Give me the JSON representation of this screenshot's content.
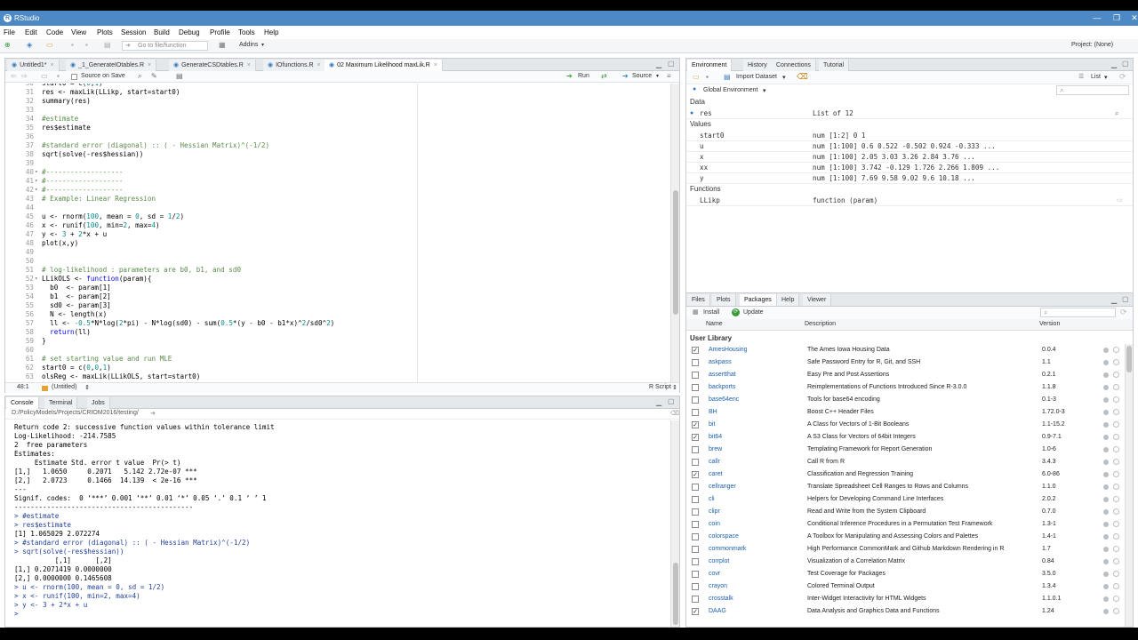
{
  "titlebar": {
    "app_name": "RStudio"
  },
  "menu": [
    "File",
    "Edit",
    "Code",
    "View",
    "Plots",
    "Session",
    "Build",
    "Debug",
    "Profile",
    "Tools",
    "Help"
  ],
  "toolbar": {
    "goto_placeholder": "Go to file/function",
    "addins": "Addins",
    "project": "Project: (None)"
  },
  "editor": {
    "tabs": [
      "Untitled1*",
      "_1_GenerateIOtables.R",
      "GenerateCSDtables.R",
      "IOfunctions.R",
      "02 Maximum Likelihood maxLik.R"
    ],
    "source_on_save": "Source on Save",
    "run": "Run",
    "source": "Source",
    "status_pos": "48:1",
    "status_scope": "(Untitled)",
    "status_type": "R Script",
    "lines": [
      {
        "n": "30",
        "t": "start0 = c(0,1)"
      },
      {
        "n": "31",
        "t": "res <- maxLik(LLikp, start=start0)"
      },
      {
        "n": "32",
        "t": "summary(res)"
      },
      {
        "n": "33",
        "t": ""
      },
      {
        "n": "34",
        "t": "#estimate"
      },
      {
        "n": "35",
        "t": "res$estimate"
      },
      {
        "n": "36",
        "t": ""
      },
      {
        "n": "37",
        "t": "#standard error (diagonal) :: ( - Hessian Matrix)^(-1/2)"
      },
      {
        "n": "38",
        "t": "sqrt(solve(-res$hessian))"
      },
      {
        "n": "39",
        "t": ""
      },
      {
        "n": "40",
        "t": "#-------------------"
      },
      {
        "n": "41",
        "t": "#-------------------"
      },
      {
        "n": "42",
        "t": "#-------------------"
      },
      {
        "n": "43",
        "t": "# Example: Linear Regression"
      },
      {
        "n": "44",
        "t": ""
      },
      {
        "n": "45",
        "t": "u <- rnorm(100, mean = 0, sd = 1/2)"
      },
      {
        "n": "46",
        "t": "x <- runif(100, min=2, max=4)"
      },
      {
        "n": "47",
        "t": "y <- 3 + 2*x + u"
      },
      {
        "n": "48",
        "t": "plot(x,y)"
      },
      {
        "n": "49",
        "t": ""
      },
      {
        "n": "50",
        "t": ""
      },
      {
        "n": "51",
        "t": "# log-likelihood : parameters are b0, b1, and sd0"
      },
      {
        "n": "52",
        "t": "LLikOLS <- function(param){"
      },
      {
        "n": "53",
        "t": "  b0  <- param[1]"
      },
      {
        "n": "54",
        "t": "  b1  <- param[2]"
      },
      {
        "n": "55",
        "t": "  sd0 <- param[3]"
      },
      {
        "n": "56",
        "t": "  N <- length(x)"
      },
      {
        "n": "57",
        "t": "  ll <- -0.5*N*log(2*pi) - N*log(sd0) - sum(0.5*(y - b0 - b1*x)^2/sd0^2)"
      },
      {
        "n": "58",
        "t": "  return(ll)"
      },
      {
        "n": "59",
        "t": "}"
      },
      {
        "n": "60",
        "t": ""
      },
      {
        "n": "61",
        "t": "# set starting value and run MLE"
      },
      {
        "n": "62",
        "t": "start0 = c(0,0,1)"
      },
      {
        "n": "63",
        "t": "olsReg <- maxLik(LLikOLS, start=start0)"
      }
    ]
  },
  "console": {
    "tabs": [
      "Console",
      "Terminal",
      "Jobs"
    ],
    "path": "D:/PolicyModels/Projects/CRIOM2016/testing/",
    "lines": [
      {
        "k": "out",
        "t": "Return code 2: successive function values within tolerance limit"
      },
      {
        "k": "out",
        "t": "Log-Likelihood: -214.7585"
      },
      {
        "k": "out",
        "t": "2  free parameters"
      },
      {
        "k": "out",
        "t": "Estimates:"
      },
      {
        "k": "out",
        "t": "     Estimate Std. error t value  Pr(> t)"
      },
      {
        "k": "out",
        "t": "[1,]   1.0650     0.2071   5.142 2.72e-07 ***"
      },
      {
        "k": "out",
        "t": "[2,]   2.0723     0.1466  14.139  < 2e-16 ***"
      },
      {
        "k": "out",
        "t": "---"
      },
      {
        "k": "out",
        "t": "Signif. codes:  0 ‘***’ 0.001 ‘**’ 0.01 ‘*’ 0.05 ‘.’ 0.1 ‘ ’ 1"
      },
      {
        "k": "out",
        "t": "--------------------------------------------"
      },
      {
        "k": "in",
        "t": "> #estimate"
      },
      {
        "k": "in",
        "t": "> res$estimate"
      },
      {
        "k": "out",
        "t": "[1] 1.065029 2.072274"
      },
      {
        "k": "in",
        "t": "> #standard error (diagonal) :: ( - Hessian Matrix)^(-1/2)"
      },
      {
        "k": "in",
        "t": "> sqrt(solve(-res$hessian))"
      },
      {
        "k": "out",
        "t": "          [,1]      [,2]"
      },
      {
        "k": "out",
        "t": "[1,] 0.2071419 0.0000000"
      },
      {
        "k": "out",
        "t": "[2,] 0.0000000 0.1465608"
      },
      {
        "k": "in",
        "t": "> u <- rnorm(100, mean = 0, sd = 1/2)"
      },
      {
        "k": "in",
        "t": "> x <- runif(100, min=2, max=4)"
      },
      {
        "k": "in",
        "t": "> y <- 3 + 2*x + u"
      },
      {
        "k": "in",
        "t": "> "
      }
    ]
  },
  "environment": {
    "tabs": [
      "Environment",
      "History",
      "Connections",
      "Tutorial"
    ],
    "import_dataset": "Import Dataset",
    "list_view": "List",
    "scope": "Global Environment",
    "section_data": "Data",
    "section_values": "Values",
    "section_functions": "Functions",
    "data": [
      {
        "name": "res",
        "value": "List of 12"
      }
    ],
    "values": [
      {
        "name": "start0",
        "value": "num [1:2] 0 1"
      },
      {
        "name": "u",
        "value": "num [1:100] 0.6 0.522 -0.502 0.924 -0.333 ..."
      },
      {
        "name": "x",
        "value": "num [1:100] 2.05 3.03 3.26 2.84 3.76 ..."
      },
      {
        "name": "xx",
        "value": "num [1:100] 3.742 -0.129 1.726 2.266 1.809 ..."
      },
      {
        "name": "y",
        "value": "num [1:100] 7.69 9.58 9.02 9.6 10.18 ..."
      }
    ],
    "functions": [
      {
        "name": "LLikp",
        "value": "function (param)"
      }
    ]
  },
  "packages": {
    "tabs": [
      "Files",
      "Plots",
      "Packages",
      "Help",
      "Viewer"
    ],
    "install": "Install",
    "update": "Update",
    "col_name": "Name",
    "col_desc": "Description",
    "col_version": "Version",
    "section": "User Library",
    "rows": [
      {
        "c": "✓",
        "name": "AmesHousing",
        "desc": "The Ames Iowa Housing Data",
        "ver": "0.0.4"
      },
      {
        "c": "",
        "name": "askpass",
        "desc": "Safe Password Entry for R, Git, and SSH",
        "ver": "1.1"
      },
      {
        "c": "",
        "name": "assertthat",
        "desc": "Easy Pre and Post Assertions",
        "ver": "0.2.1"
      },
      {
        "c": "",
        "name": "backports",
        "desc": "Reimplementations of Functions Introduced Since R-3.0.0",
        "ver": "1.1.8"
      },
      {
        "c": "",
        "name": "base64enc",
        "desc": "Tools for base64 encoding",
        "ver": "0.1-3"
      },
      {
        "c": "",
        "name": "BH",
        "desc": "Boost C++ Header Files",
        "ver": "1.72.0-3"
      },
      {
        "c": "✓",
        "name": "bit",
        "desc": "A Class for Vectors of 1-Bit Booleans",
        "ver": "1.1-15.2"
      },
      {
        "c": "✓",
        "name": "bit64",
        "desc": "A S3 Class for Vectors of 64bit Integers",
        "ver": "0.9-7.1"
      },
      {
        "c": "",
        "name": "brew",
        "desc": "Templating Framework for Report Generation",
        "ver": "1.0-6"
      },
      {
        "c": "",
        "name": "callr",
        "desc": "Call R from R",
        "ver": "3.4.3"
      },
      {
        "c": "✓",
        "name": "caret",
        "desc": "Classification and Regression Training",
        "ver": "6.0-86"
      },
      {
        "c": "",
        "name": "cellranger",
        "desc": "Translate Spreadsheet Cell Ranges to Rows and Columns",
        "ver": "1.1.0"
      },
      {
        "c": "",
        "name": "cli",
        "desc": "Helpers for Developing Command Line Interfaces",
        "ver": "2.0.2"
      },
      {
        "c": "",
        "name": "clipr",
        "desc": "Read and Write from the System Clipboard",
        "ver": "0.7.0"
      },
      {
        "c": "",
        "name": "coin",
        "desc": "Conditional Inference Procedures in a Permutation Test Framework",
        "ver": "1.3-1"
      },
      {
        "c": "",
        "name": "colorspace",
        "desc": "A Toolbox for Manipulating and Assessing Colors and Palettes",
        "ver": "1.4-1"
      },
      {
        "c": "",
        "name": "commonmark",
        "desc": "High Performance CommonMark and Github Markdown Rendering in R",
        "ver": "1.7"
      },
      {
        "c": "",
        "name": "corrplot",
        "desc": "Visualization of a Correlation Matrix",
        "ver": "0.84"
      },
      {
        "c": "",
        "name": "covr",
        "desc": "Test Coverage for Packages",
        "ver": "3.5.0"
      },
      {
        "c": "",
        "name": "crayon",
        "desc": "Colored Terminal Output",
        "ver": "1.3.4"
      },
      {
        "c": "",
        "name": "crosstalk",
        "desc": "Inter-Widget Interactivity for HTML Widgets",
        "ver": "1.1.0.1"
      },
      {
        "c": "✓",
        "name": "DAAG",
        "desc": "Data Analysis and Graphics Data and Functions",
        "ver": "1.24"
      }
    ]
  }
}
